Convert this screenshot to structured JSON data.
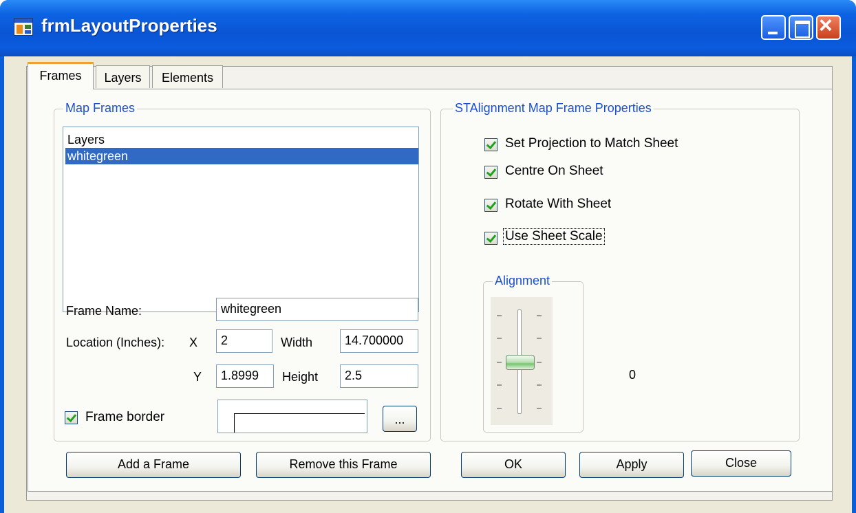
{
  "window": {
    "title": "frmLayoutProperties"
  },
  "tabs": [
    {
      "label": "Frames",
      "active": true
    },
    {
      "label": "Layers",
      "active": false
    },
    {
      "label": "Elements",
      "active": false
    }
  ],
  "map_frames": {
    "title": "Map Frames",
    "items": [
      {
        "label": "Layers",
        "selected": false
      },
      {
        "label": "whitegreen",
        "selected": true
      }
    ],
    "frame_name_label": "Frame Name:",
    "frame_name_value": "whitegreen",
    "location_label": "Location (Inches):",
    "x_label": "X",
    "x_value": "2",
    "y_label": "Y",
    "y_value": "1.8999",
    "width_label": "Width",
    "width_value": "14.700000",
    "height_label": "Height",
    "height_value": "2.5",
    "frame_border_label": "Frame border",
    "frame_border_checked": true,
    "browse_label": "..."
  },
  "properties": {
    "title": "STAlignment Map Frame Properties",
    "checkboxes": [
      {
        "label": "Set Projection to Match Sheet",
        "checked": true
      },
      {
        "label": "Centre On Sheet",
        "checked": true
      },
      {
        "label": "Rotate With Sheet",
        "checked": true
      },
      {
        "label": "Use Sheet Scale",
        "checked": true
      }
    ],
    "alignment_title": "Alignment",
    "alignment_value": "0"
  },
  "buttons": {
    "add": "Add a Frame",
    "remove": "Remove this Frame",
    "ok": "OK",
    "apply": "Apply",
    "close": "Close"
  }
}
